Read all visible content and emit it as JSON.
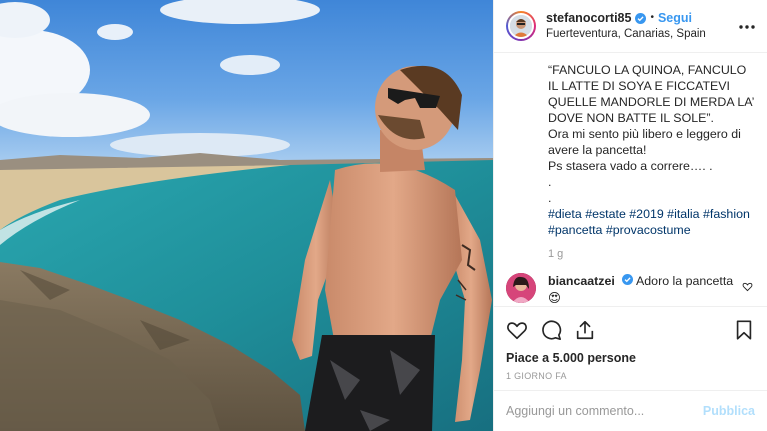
{
  "post": {
    "username": "stefanocorti85",
    "verified": true,
    "separator": "•",
    "follow_label": "Segui",
    "location": "Fuerteventura, Canarias, Spain",
    "more_label": "•••",
    "photo_alt": "stefanocorti85"
  },
  "caption": {
    "line1": "“FANCULO LA QUINOA, FANCULO IL LATTE DI SOYA E FICCATEVI QUELLE MANDORLE DI MERDA LA’ DOVE NON BATTE IL SOLE”.",
    "line2": "Ora mi sento più libero e leggero di avere la pancetta!",
    "line3": "Ps stasera vado a correre…. .",
    "line4": ".",
    "line5": ".",
    "hashtags_line1": "#dieta #estate #2019 #italia #fashion",
    "hashtags_line2": "#pancetta #provacostume",
    "time": "1 g"
  },
  "comment": {
    "username": "biancaatzei",
    "verified": true,
    "text": "Adoro la pancetta",
    "emoji": "😍"
  },
  "actions": {
    "likes": "Piace a 5.000 persone",
    "date": "1 GIORNO FA"
  },
  "add_comment": {
    "placeholder": "Aggiungi un commento...",
    "publish_label": "Pubblica"
  },
  "colors": {
    "link_blue": "#3897f0",
    "hashtag": "#003569",
    "muted": "#999999",
    "publish_disabled": "#b2dffc"
  }
}
